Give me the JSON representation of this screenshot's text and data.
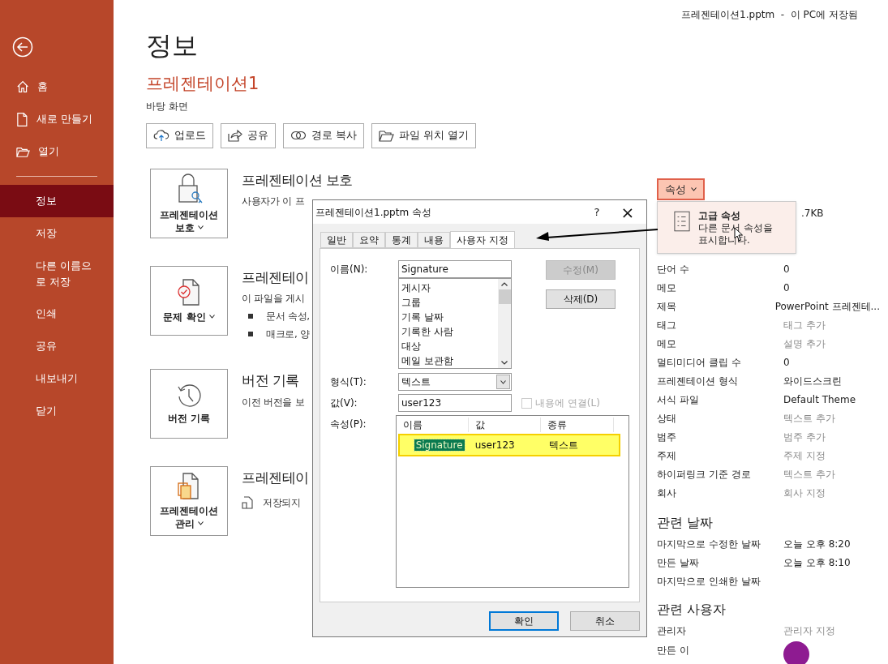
{
  "window": {
    "file_status": "프레젠테이션1.pptm  -  이 PC에 저장됨"
  },
  "sidebar": {
    "items": [
      {
        "label": "홈",
        "selected": false
      },
      {
        "label": "새로 만들기",
        "selected": false
      },
      {
        "label": "열기",
        "selected": false
      },
      {
        "label": "정보",
        "selected": true,
        "divider_before": true
      },
      {
        "label": "저장",
        "selected": false
      },
      {
        "label": "다른 이름으로 저장",
        "selected": false
      },
      {
        "label": "인쇄",
        "selected": false
      },
      {
        "label": "공유",
        "selected": false
      },
      {
        "label": "내보내기",
        "selected": false
      },
      {
        "label": "닫기",
        "selected": false
      }
    ]
  },
  "page": {
    "title": "정보",
    "document_name": "프레젠테이션1",
    "location": "바탕 화면",
    "actions": [
      "업로드",
      "공유",
      "경로 복사",
      "파일 위치 열기"
    ],
    "sections": [
      {
        "button": "프레젠테이션 보호",
        "title": "프레젠테이션 보호",
        "lines": [
          {
            "kind": "text",
            "text": "사용자가 이 프"
          }
        ]
      },
      {
        "button": "문제 확인",
        "title": "프레젠테이",
        "lines": [
          {
            "kind": "text",
            "text": "이 파일을 게시"
          },
          {
            "kind": "bullet",
            "text": "문서 속성,"
          },
          {
            "kind": "bullet",
            "text": "매크로, 양"
          }
        ]
      },
      {
        "button": "버전 기록",
        "title": "버전 기록",
        "lines": [
          {
            "kind": "text",
            "text": "이전 버전을 보"
          }
        ]
      },
      {
        "button": "프레젠테이션 관리",
        "title": "프레젠테이",
        "lines": [
          {
            "kind": "file",
            "text": "저장되지"
          }
        ]
      }
    ]
  },
  "properties_panel": {
    "button": "속성",
    "size_value": ".7KB",
    "menu": {
      "title": "고급 속성",
      "description": "다른 문서 속성을 표시합니다."
    },
    "rows": [
      {
        "label": "단어 수",
        "value": "0",
        "kind": "text"
      },
      {
        "label": "메모",
        "value": "0",
        "kind": "text"
      },
      {
        "label": "제목",
        "value": "PowerPoint 프레젠테...",
        "kind": "text"
      },
      {
        "label": "태그",
        "value": "태그 추가",
        "kind": "prompt"
      },
      {
        "label": "메모",
        "value": "설명 추가",
        "kind": "prompt"
      },
      {
        "label": "멀티미디어 클립 수",
        "value": "0",
        "kind": "text"
      },
      {
        "label": "프레젠테이션 형식",
        "value": "와이드스크린",
        "kind": "text"
      },
      {
        "label": "서식 파일",
        "value": "Default Theme",
        "kind": "text"
      },
      {
        "label": "상태",
        "value": "텍스트 추가",
        "kind": "prompt"
      },
      {
        "label": "범주",
        "value": "범주 추가",
        "kind": "prompt"
      },
      {
        "label": "주제",
        "value": "주제 지정",
        "kind": "prompt"
      },
      {
        "label": "하이퍼링크 기준 경로",
        "value": "텍스트 추가",
        "kind": "prompt"
      },
      {
        "label": "회사",
        "value": "회사 지정",
        "kind": "prompt"
      }
    ],
    "dates_heading": "관련 날짜",
    "dates": [
      {
        "label": "마지막으로 수정한 날짜",
        "value": "오늘 오후 8:20"
      },
      {
        "label": "만든 날짜",
        "value": "오늘 오후 8:10"
      },
      {
        "label": "마지막으로 인쇄한 날짜"
      }
    ],
    "people_heading": "관련 사용자",
    "people": [
      {
        "label": "관리자",
        "value": "관리자 지정",
        "kind": "prompt"
      },
      {
        "label": "만든 이",
        "kind": "avatar"
      }
    ]
  },
  "dialog": {
    "title": "프레젠테이션1.pptm 속성",
    "help": "?",
    "close": "×",
    "tabs": [
      {
        "label": "일반",
        "selected": false
      },
      {
        "label": "요약",
        "selected": false
      },
      {
        "label": "통계",
        "selected": false
      },
      {
        "label": "내용",
        "selected": false
      },
      {
        "label": "사용자 지정",
        "selected": true
      }
    ],
    "name_label": "이름(N):",
    "name_value": "Signature",
    "name_options": [
      "게시자",
      "그룹",
      "기록 날짜",
      "기록한 사람",
      "대상",
      "메일 보관함"
    ],
    "modify_button": {
      "label": "수정(M)",
      "disabled": true
    },
    "delete_button": {
      "label": "삭제(D)",
      "disabled": false
    },
    "type_label": "형식(T):",
    "type_value": "텍스트",
    "value_label": "값(V):",
    "value_value": "user123",
    "link_checkbox": {
      "label": "내용에 연결(L)",
      "checked": false,
      "disabled": true
    },
    "properties_label": "속성(P):",
    "columns": [
      "이름",
      "값",
      "종류"
    ],
    "rows": [
      {
        "name": "Signature",
        "value": "user123",
        "type": "텍스트",
        "selected": true,
        "highlighted": true
      }
    ],
    "ok_button": "확인",
    "cancel_button": "취소"
  }
}
